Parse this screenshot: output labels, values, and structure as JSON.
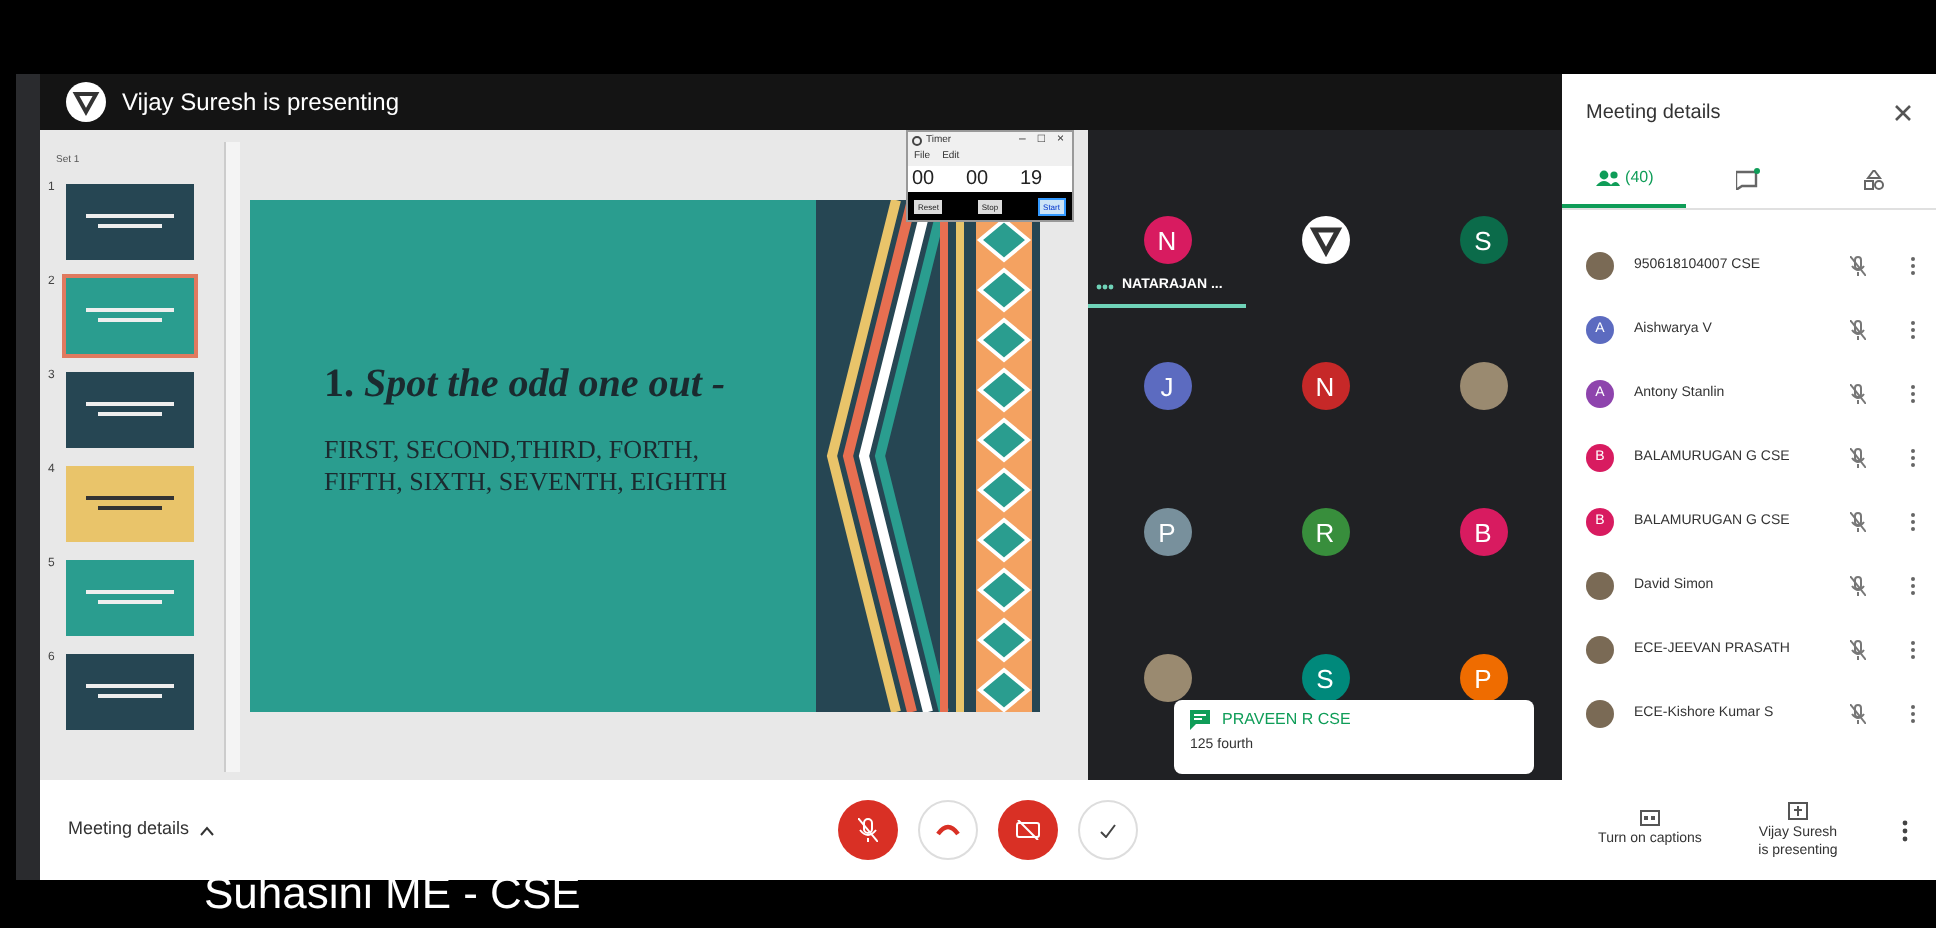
{
  "presenter_bar": {
    "title": "Vijay Suresh is presenting"
  },
  "slides_pane": {
    "section": "Set 1",
    "thumbnails": [
      {
        "number": "1",
        "kind": "dark",
        "selected": false
      },
      {
        "number": "2",
        "kind": "teal",
        "selected": true
      },
      {
        "number": "3",
        "kind": "dark",
        "selected": false
      },
      {
        "number": "4",
        "kind": "yellow",
        "selected": false
      },
      {
        "number": "5",
        "kind": "teal",
        "selected": false
      },
      {
        "number": "6",
        "kind": "dark",
        "selected": false
      }
    ]
  },
  "slide": {
    "heading_number": "1.",
    "heading": "Spot the odd one out -",
    "body": [
      "FIRST, SECOND,THIRD, FORTH,",
      "FIFTH, SIXTH, SEVENTH, EIGHTH"
    ]
  },
  "timer": {
    "title": "Timer",
    "window_controls": [
      "–",
      "□",
      "×"
    ],
    "menu": [
      "File",
      "Edit"
    ],
    "fields": [
      "00",
      "00",
      "19"
    ],
    "buttons": [
      {
        "label": "Reset",
        "selected": false
      },
      {
        "label": "Stop",
        "selected": false
      },
      {
        "label": "Start",
        "selected": true
      }
    ]
  },
  "grid": {
    "tiles": [
      {
        "kind": "letter",
        "letter": "N",
        "color": "#d81b60",
        "name": "NATARAJAN ...",
        "speaking": true
      },
      {
        "kind": "logo",
        "speaking": false
      },
      {
        "kind": "letter",
        "letter": "S",
        "color": "#0b6b4a",
        "speaking": false
      },
      {
        "kind": "letter",
        "letter": "J",
        "color": "#5c6bc0",
        "speaking": false
      },
      {
        "kind": "letter",
        "letter": "N",
        "color": "#c62828",
        "speaking": false
      },
      {
        "kind": "photo",
        "speaking": false
      },
      {
        "kind": "letter",
        "letter": "P",
        "color": "#78909c",
        "speaking": false
      },
      {
        "kind": "letter",
        "letter": "R",
        "color": "#388e3c",
        "speaking": false
      },
      {
        "kind": "letter",
        "letter": "B",
        "color": "#d81b60",
        "speaking": false
      },
      {
        "kind": "photo",
        "speaking": false
      },
      {
        "kind": "letter",
        "letter": "S",
        "color": "#00897b",
        "speaking": false
      },
      {
        "kind": "letter",
        "letter": "P",
        "color": "#ef6c00",
        "speaking": false
      }
    ]
  },
  "chat_toast": {
    "sender": "PRAVEEN R CSE",
    "message": "125 fourth"
  },
  "side_panel": {
    "title": "Meeting details",
    "tabs": [
      {
        "kind": "people",
        "label": "(40)",
        "selected": true
      },
      {
        "kind": "chat",
        "unread": true,
        "selected": false
      },
      {
        "kind": "activities",
        "selected": false
      }
    ],
    "participants": [
      {
        "kind": "photo",
        "name": "950618104007 CSE",
        "muted": true
      },
      {
        "kind": "letter",
        "letter": "A",
        "color": "#5c6bc0",
        "name": "Aishwarya V",
        "muted": true
      },
      {
        "kind": "letter",
        "letter": "A",
        "color": "#8e44ad",
        "name": "Antony Stanlin",
        "muted": true
      },
      {
        "kind": "letter",
        "letter": "B",
        "color": "#d81b60",
        "name": "BALAMURUGAN G CSE",
        "muted": true
      },
      {
        "kind": "letter",
        "letter": "B",
        "color": "#d81b60",
        "name": "BALAMURUGAN G CSE",
        "muted": true
      },
      {
        "kind": "photo",
        "name": "David Simon",
        "muted": true
      },
      {
        "kind": "photo",
        "name": "ECE-JEEVAN PRASATH",
        "muted": true
      },
      {
        "kind": "photo",
        "name": "ECE-Kishore Kumar S",
        "muted": true
      }
    ]
  },
  "bottom_bar": {
    "details_label": "Meeting details",
    "mic_on": false,
    "camera_on": false,
    "captions_label": "Turn on captions",
    "presenting_label": [
      "Vijay Suresh",
      "is presenting"
    ]
  },
  "caption": {
    "name": "Suhasini ME - CSE"
  }
}
